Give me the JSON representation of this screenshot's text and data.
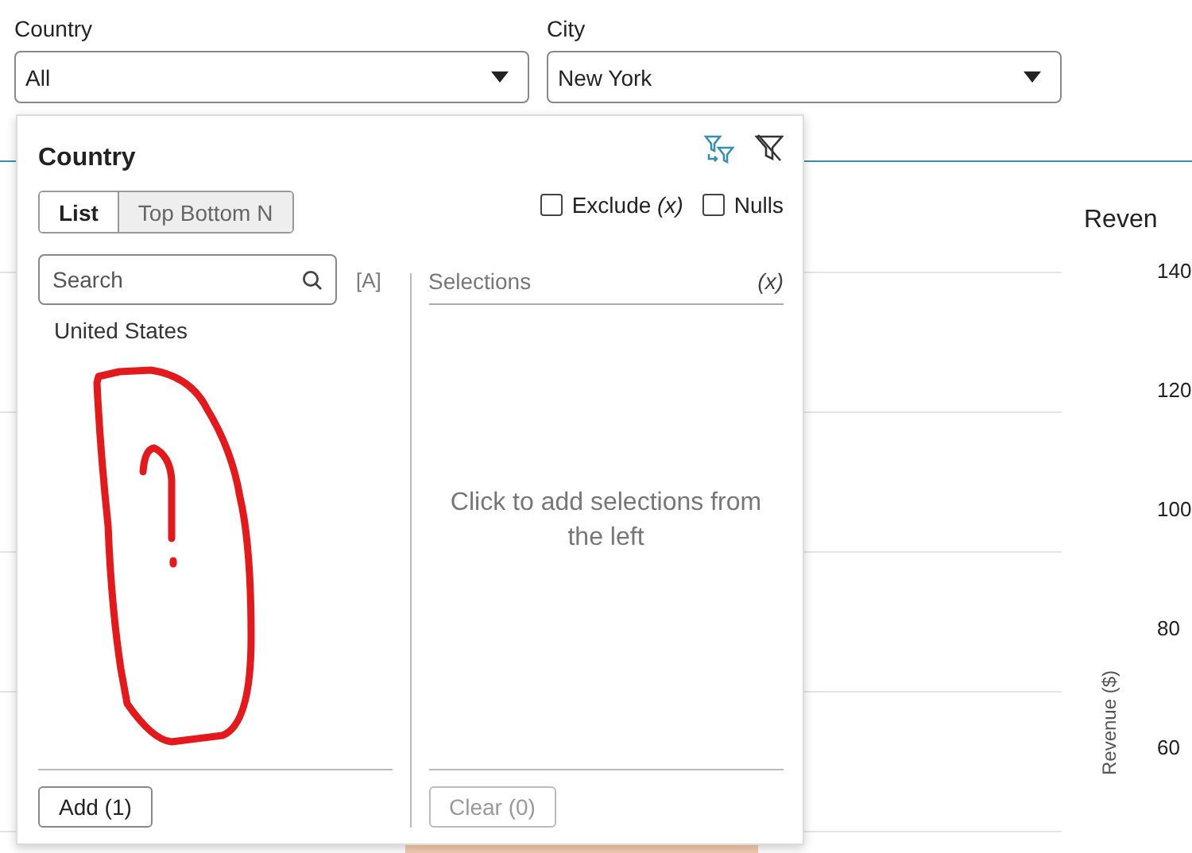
{
  "filters": [
    {
      "label": "Country",
      "value": "All"
    },
    {
      "label": "City",
      "value": "New York"
    }
  ],
  "chart": {
    "title": "Reven",
    "yticks": [
      "140",
      "120",
      "100",
      "80",
      "60"
    ],
    "ylabel": "Revenue ($)"
  },
  "popup": {
    "title": "Country",
    "modes": [
      {
        "label": "List",
        "selected": true
      },
      {
        "label": "Top Bottom N",
        "selected": false
      }
    ],
    "options": [
      {
        "label": "Exclude *(x)*",
        "checked": false
      },
      {
        "label": "Nulls",
        "checked": false
      }
    ],
    "search": {
      "placeholder": "Search"
    },
    "case_toggle": "[A]",
    "values": [
      {
        "label": "United States"
      }
    ],
    "selections_header": "Selections",
    "selections_toggle": "(x)",
    "empty_message": "Click to add selections from the left",
    "add_button": {
      "label": "Add (1)",
      "disabled": false
    },
    "clear_button": {
      "label": "Clear (0)",
      "disabled": true
    }
  }
}
